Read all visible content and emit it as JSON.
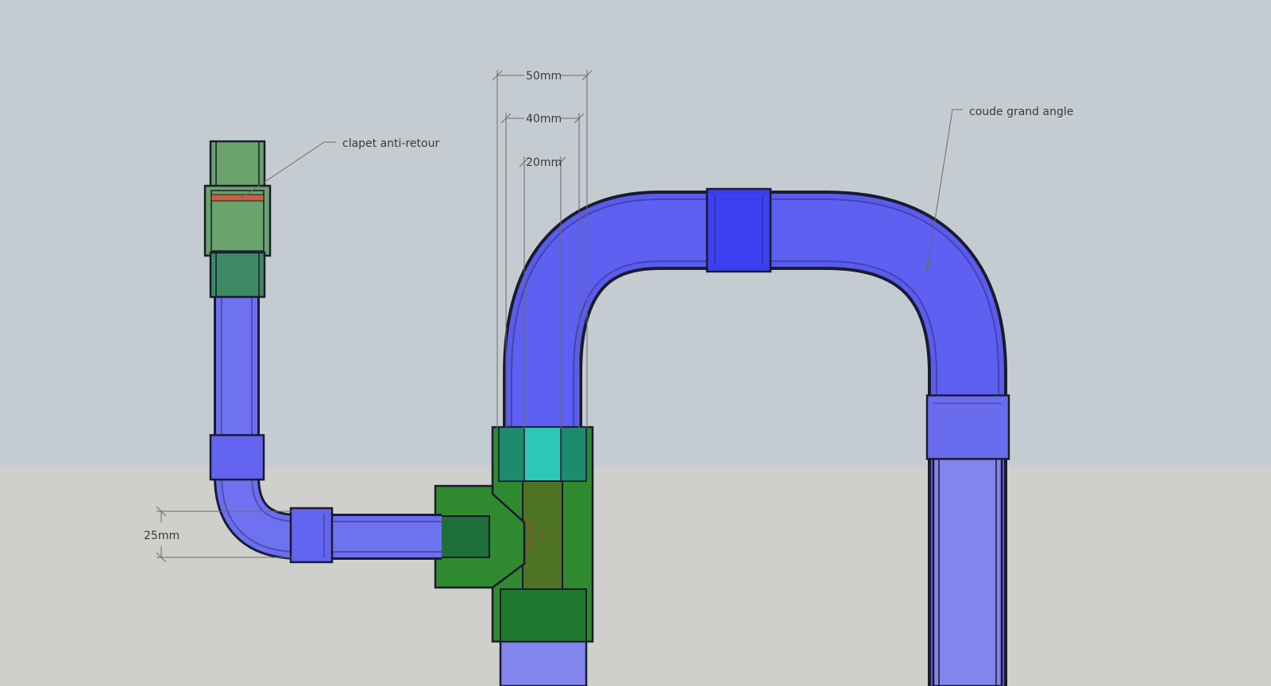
{
  "colors": {
    "sky": "#c5ccd1",
    "ground": "#cfcfcb",
    "pipe_blue": "#5a5cf0",
    "pipe_blue_light": "#7f82ee",
    "pipe_blue_dark": "#3b3ef2",
    "fitting_green": "#2f8a2f",
    "fitting_green_dark": "#1e6e3a",
    "valve_green": "#6aa36c",
    "cyan_part": "#2fc7b8",
    "olive_part": "#4f7324",
    "valve_disc": "#c9613e",
    "outline": "#1b1b2e"
  },
  "dimensions": [
    {
      "name": "dim-50mm",
      "label": "50mm"
    },
    {
      "name": "dim-40mm",
      "label": "40mm"
    },
    {
      "name": "dim-20mm",
      "label": "20mm"
    },
    {
      "name": "dim-25mm",
      "label": "25mm"
    }
  ],
  "annotations": [
    {
      "name": "label-clapet-anti-retour",
      "text": "clapet anti-retour"
    },
    {
      "name": "label-coude-grand-angle",
      "text": "coude grand angle"
    }
  ],
  "pointer_mark": "↑"
}
